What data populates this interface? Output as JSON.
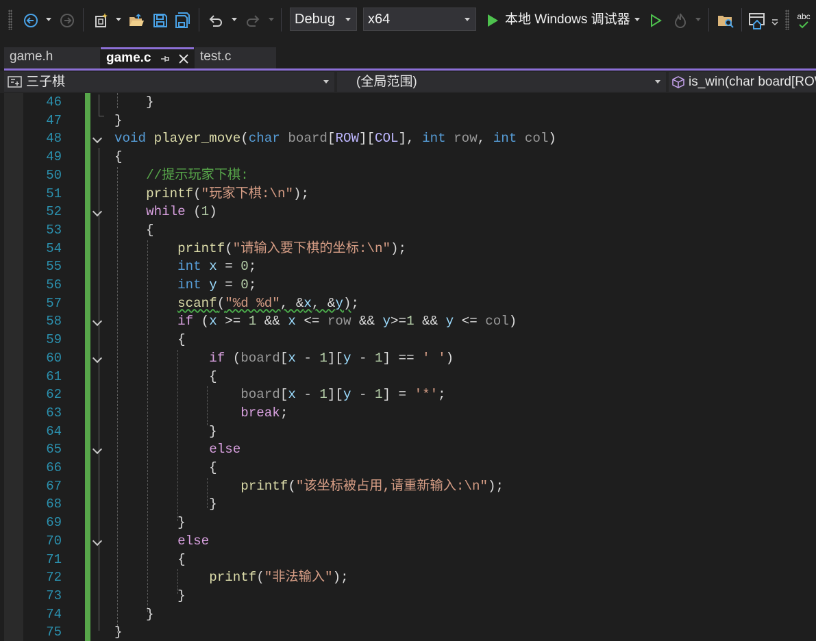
{
  "toolbar": {
    "configuration": "Debug",
    "platform": "x64",
    "debugger": "本地 Windows 调试器",
    "spell_check": "abc"
  },
  "tabs": [
    {
      "label": "game.h",
      "active": false
    },
    {
      "label": "game.c",
      "active": true
    },
    {
      "label": "test.c",
      "active": false
    }
  ],
  "navbar": {
    "project": "三子棋",
    "scope": "(全局范围)",
    "member": "is_win(char board[ROW"
  },
  "colors": {
    "accent": "#8c6fd6",
    "change_bar": "#57a64a",
    "line_number": "#2b91af",
    "keyword": "#569cd6",
    "control": "#d8a0df",
    "function": "#dcdcaa",
    "string": "#d69d85",
    "comment": "#57a64a"
  },
  "editor": {
    "lines": [
      {
        "n": "46",
        "text": "    }"
      },
      {
        "n": "47",
        "text": "}"
      },
      {
        "n": "48",
        "text": "void player_move(char board[ROW][COL], int row, int col)"
      },
      {
        "n": "49",
        "text": "{"
      },
      {
        "n": "50",
        "text": "    //提示玩家下棋:"
      },
      {
        "n": "51",
        "text": "    printf(\"玩家下棋:\\n\");"
      },
      {
        "n": "52",
        "text": "    while (1)"
      },
      {
        "n": "53",
        "text": "    {"
      },
      {
        "n": "54",
        "text": "        printf(\"请输入要下棋的坐标:\\n\");"
      },
      {
        "n": "55",
        "text": "        int x = 0;"
      },
      {
        "n": "56",
        "text": "        int y = 0;"
      },
      {
        "n": "57",
        "text": "        scanf(\"%d %d\", &x, &y);"
      },
      {
        "n": "58",
        "text": "        if (x >= 1 && x <= row && y>=1 && y <= col)"
      },
      {
        "n": "59",
        "text": "        {"
      },
      {
        "n": "60",
        "text": "            if (board[x - 1][y - 1] == ' ')"
      },
      {
        "n": "61",
        "text": "            {"
      },
      {
        "n": "62",
        "text": "                board[x - 1][y - 1] = '*';"
      },
      {
        "n": "63",
        "text": "                break;"
      },
      {
        "n": "64",
        "text": "            }"
      },
      {
        "n": "65",
        "text": "            else"
      },
      {
        "n": "66",
        "text": "            {"
      },
      {
        "n": "67",
        "text": "                printf(\"该坐标被占用,请重新输入:\\n\");"
      },
      {
        "n": "68",
        "text": "            }"
      },
      {
        "n": "69",
        "text": "        }"
      },
      {
        "n": "70",
        "text": "        else"
      },
      {
        "n": "71",
        "text": "        {"
      },
      {
        "n": "72",
        "text": "            printf(\"非法输入\");"
      },
      {
        "n": "73",
        "text": "        }"
      },
      {
        "n": "74",
        "text": "    }"
      },
      {
        "n": "75",
        "text": "}"
      }
    ]
  }
}
